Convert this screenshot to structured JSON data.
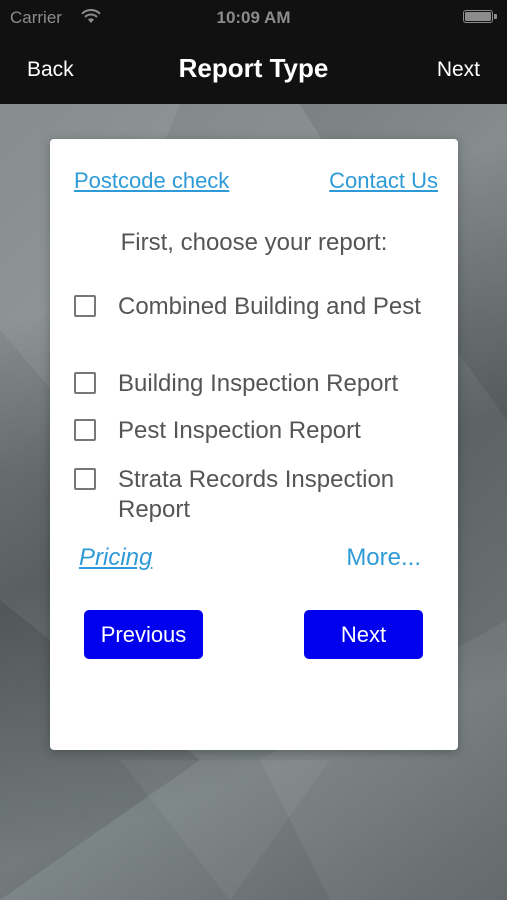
{
  "status_bar": {
    "carrier": "Carrier",
    "time": "10:09 AM",
    "wifi_icon": "wifi-icon",
    "battery_icon": "battery-icon"
  },
  "nav": {
    "back_label": "Back",
    "title": "Report Type",
    "next_label": "Next"
  },
  "card": {
    "postcode_link": "Postcode check",
    "contact_link": "Contact Us",
    "prompt": "First, choose your report:",
    "options": [
      {
        "label": "Combined Building and Pest",
        "checked": false
      },
      {
        "label": "Building Inspection Report",
        "checked": false
      },
      {
        "label": "Pest Inspection Report",
        "checked": false
      },
      {
        "label": "Strata Records Inspection Report",
        "checked": false
      }
    ],
    "pricing_link": "Pricing",
    "more_link": "More...",
    "previous_button": "Previous",
    "next_button": "Next"
  },
  "colors": {
    "nav_background": "#111111",
    "link": "#2e9bd8",
    "button": "#0000ee",
    "text": "#555555"
  }
}
